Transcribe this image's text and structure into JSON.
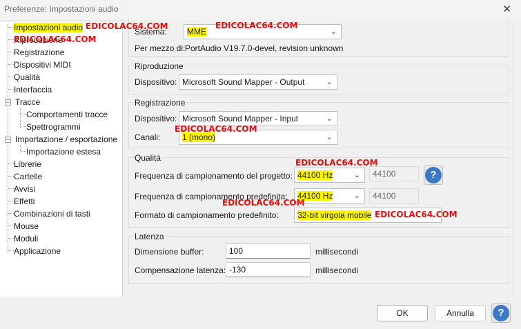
{
  "window": {
    "title": "Preferenze: Impostazioni audio",
    "close": "✕"
  },
  "tree": {
    "items": [
      {
        "label": "Impostazioni audio"
      },
      {
        "label": "Riproduzione"
      },
      {
        "label": "Registrazione"
      },
      {
        "label": "Dispositivi MIDI"
      },
      {
        "label": "Qualità"
      },
      {
        "label": "Interfaccia"
      },
      {
        "label": "Tracce",
        "expander": "−"
      },
      {
        "label": "Comportamenti tracce"
      },
      {
        "label": "Spettrogrammi"
      },
      {
        "label": "Importazione / esportazione",
        "expander": "−"
      },
      {
        "label": "Importazione estesa"
      },
      {
        "label": "Librerie"
      },
      {
        "label": "Cartelle"
      },
      {
        "label": "Avvisi"
      },
      {
        "label": "Effetti"
      },
      {
        "label": "Combinazioni di tasti"
      },
      {
        "label": "Mouse"
      },
      {
        "label": "Moduli"
      },
      {
        "label": "Applicazione"
      }
    ]
  },
  "interface": {
    "sistema_label": "Sistema:",
    "sistema_value": "MME",
    "via_label": "Per mezzo di:",
    "via_value": "PortAudio V19.7.0-devel, revision unknown"
  },
  "playback": {
    "title": "Riproduzione",
    "device_label": "Dispositivo:",
    "device_value": "Microsoft Sound Mapper - Output"
  },
  "recording": {
    "title": "Registrazione",
    "device_label": "Dispositivo:",
    "device_value": "Microsoft Sound Mapper - Input",
    "channels_label": "Canali:",
    "channels_value": "1 (mono)"
  },
  "quality": {
    "title": "Qualità",
    "project_rate_label": "Frequenza di campionamento del progetto:",
    "project_rate_value": "44100 Hz",
    "project_rate_custom": "44100",
    "default_rate_label": "Frequenza di campionamento predefinita:",
    "default_rate_value": "44100 Hz",
    "default_rate_custom": "44100",
    "format_label": "Formato di campionamento predefinito:",
    "format_value": "32-bit virgola mobile"
  },
  "latency": {
    "title": "Latenza",
    "buffer_label": "Dimensione buffer:",
    "buffer_value": "100",
    "buffer_unit": "millisecondi",
    "comp_label": "Compensazione latenza:",
    "comp_value": "-130",
    "comp_unit": "millisecondi"
  },
  "buttons": {
    "ok": "OK",
    "cancel": "Annulla",
    "help": "?"
  },
  "watermark": "EDICOLAC64.COM",
  "colors": {
    "highlight": "#fff600",
    "watermark": "#e01010",
    "help_icon": "#3b79c4"
  }
}
